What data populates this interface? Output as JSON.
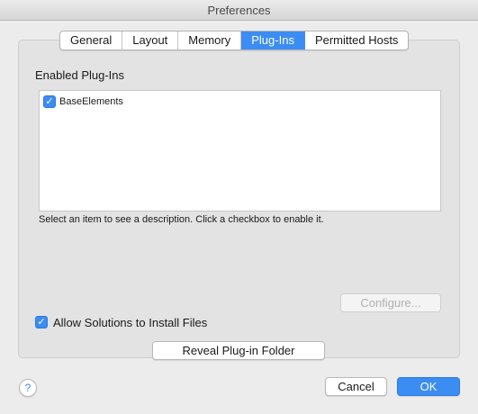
{
  "window": {
    "title": "Preferences"
  },
  "tabs": [
    {
      "label": "General",
      "active": false
    },
    {
      "label": "Layout",
      "active": false
    },
    {
      "label": "Memory",
      "active": false
    },
    {
      "label": "Plug-Ins",
      "active": true
    },
    {
      "label": "Permitted Hosts",
      "active": false
    }
  ],
  "plugins": {
    "section_label": "Enabled Plug-Ins",
    "items": [
      {
        "label": "BaseElements",
        "checked": true,
        "checkmark": "✓"
      }
    ],
    "hint": "Select an item to see a description. Click a checkbox to enable it.",
    "configure_label": "Configure..."
  },
  "options": {
    "allow_install_label": "Allow Solutions to Install Files",
    "allow_install_checked": true,
    "checkmark": "✓",
    "reveal_label": "Reveal Plug-in Folder"
  },
  "footer": {
    "help_label": "?",
    "cancel_label": "Cancel",
    "ok_label": "OK"
  },
  "colors": {
    "accent": "#3b8cf3",
    "window_bg": "#ececec"
  }
}
